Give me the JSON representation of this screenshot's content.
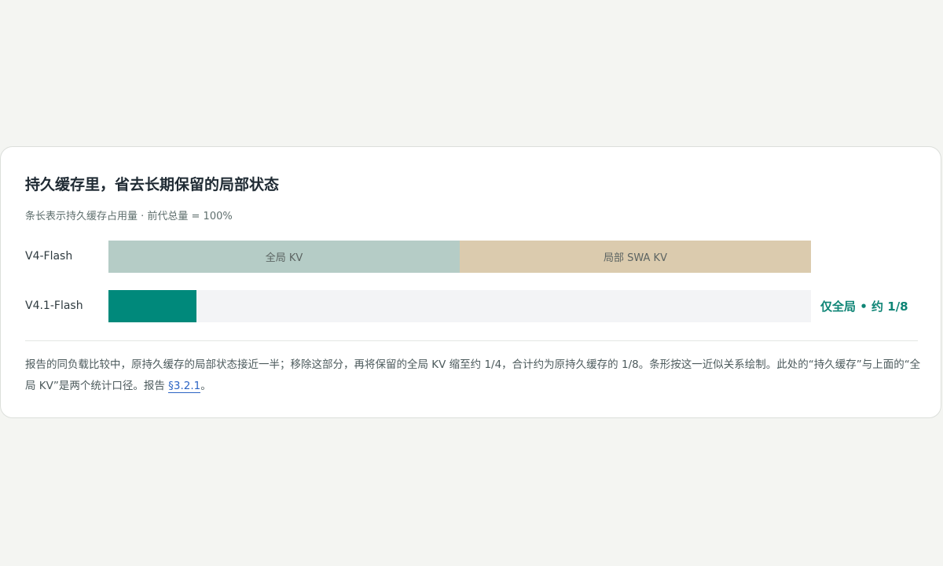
{
  "card": {
    "title": "持久缓存里，省去长期保留的局部状态",
    "subtitle": "条长表示持久缓存占用量 · 前代总量 = 100%"
  },
  "chart_data": {
    "type": "bar",
    "orientation": "horizontal",
    "stacked": true,
    "unit": "%",
    "xlim": [
      0,
      100
    ],
    "categories": [
      "V4-Flash",
      "V4.1-Flash"
    ],
    "series": [
      {
        "name": "全局 KV",
        "values": [
          50,
          12.5
        ],
        "colors": [
          "#b5ccc6",
          "#00897b"
        ]
      },
      {
        "name": "局部 SWA KV",
        "values": [
          50,
          0
        ],
        "colors": [
          "#dbcbae",
          "#dbcbae"
        ]
      }
    ],
    "track_color": "#f3f4f6",
    "annotations": [
      {
        "category": "V4.1-Flash",
        "text": "仅全局 • 约 1/8",
        "color": "#0f8576"
      }
    ]
  },
  "note": {
    "text": "报告的同负载比较中，原持久缓存的局部状态接近一半；移除这部分，再将保留的全局 KV 缩至约 1/4，合计约为原持久缓存的 1/8。条形按这一近似关系绘制。此处的“持久缓存”与上面的“全局 KV”是两个统计口径。报告 ",
    "link_label": "§3.2.1",
    "trailing": "。"
  }
}
